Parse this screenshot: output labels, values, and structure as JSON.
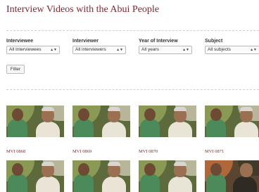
{
  "page": {
    "title": "Interview Videos with the Abui People"
  },
  "filters": [
    {
      "label": "Interviewee",
      "value": "All Interviewees"
    },
    {
      "label": "Interviewer",
      "value": "All interviewers"
    },
    {
      "label": "Year of Interview",
      "value": "All years"
    },
    {
      "label": "Subject",
      "value": "All subjects"
    }
  ],
  "filter_button": "Filter",
  "videos_row1": [
    {
      "caption": "MVI 0868"
    },
    {
      "caption": "MVI 0869"
    },
    {
      "caption": "MVI 0870"
    },
    {
      "caption": "MVI 0871"
    }
  ],
  "icons": {
    "select_arrow": "up-down-arrows-icon"
  }
}
